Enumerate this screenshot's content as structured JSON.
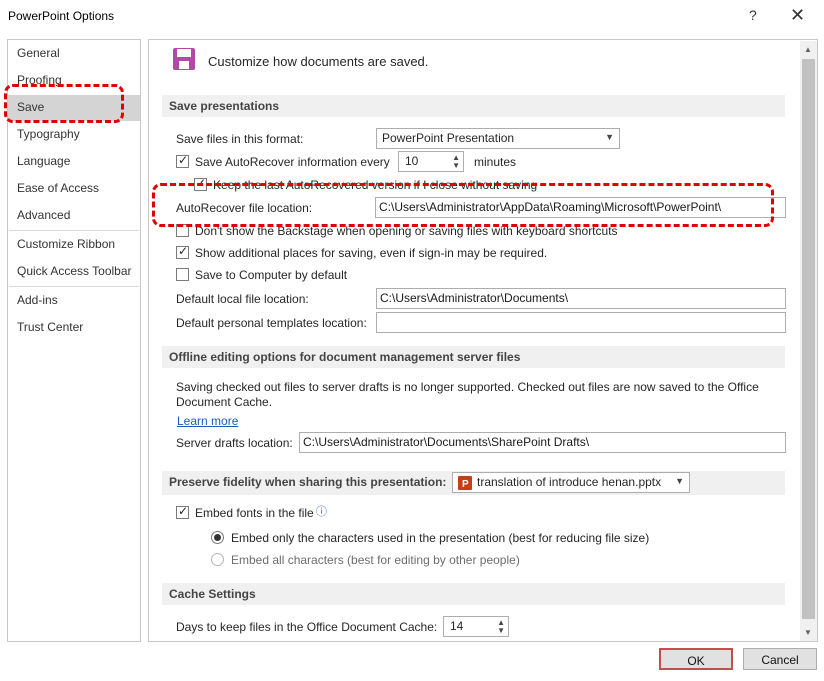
{
  "window": {
    "title": "PowerPoint Options",
    "help": "?",
    "close": "✕"
  },
  "nav": {
    "items": [
      "General",
      "Proofing",
      "Save",
      "Typography",
      "Language",
      "Ease of Access",
      "Advanced",
      "Customize Ribbon",
      "Quick Access Toolbar",
      "Add-ins",
      "Trust Center"
    ],
    "selected": "Save"
  },
  "header": {
    "text": "Customize how documents are saved."
  },
  "save_presentations": {
    "title": "Save presentations",
    "format_label": "Save files in this format:",
    "format_value": "PowerPoint Presentation",
    "autorecover_label": "Save AutoRecover information every",
    "autorecover_value": "10",
    "minutes_label": "minutes",
    "keep_last_label": "Keep the last AutoRecovered version if I close without saving",
    "autorecover_location_label": "AutoRecover file location:",
    "autorecover_location_value": "C:\\Users\\Administrator\\AppData\\Roaming\\Microsoft\\PowerPoint\\",
    "dont_show_backstage_label": "Don't show the Backstage when opening or saving files with keyboard shortcuts",
    "show_additional_label": "Show additional places for saving, even if sign-in may be required.",
    "save_to_computer_label": "Save to Computer by default",
    "default_local_label": "Default local file location:",
    "default_local_value": "C:\\Users\\Administrator\\Documents\\",
    "default_templates_label": "Default personal templates location:",
    "default_templates_value": ""
  },
  "offline": {
    "title": "Offline editing options for document management server files",
    "info_line1": "Saving checked out files to server drafts is no longer supported. Checked out files are now saved to the Office",
    "info_line2": "Document Cache.",
    "learn_more": "Learn more",
    "drafts_label": "Server drafts location:",
    "drafts_value": "C:\\Users\\Administrator\\Documents\\SharePoint Drafts\\"
  },
  "fidelity": {
    "title": "Preserve fidelity when sharing this presentation:",
    "file_value": "translation of introduce henan.pptx",
    "embed_fonts_label": "Embed fonts in the file",
    "embed_only_label": "Embed only the characters used in the presentation (best for reducing file size)",
    "embed_all_label": "Embed all characters (best for editing by other people)"
  },
  "cache": {
    "title": "Cache Settings",
    "days_label": "Days to keep files in the Office Document Cache:",
    "days_value": "14"
  },
  "buttons": {
    "ok": "OK",
    "cancel": "Cancel"
  },
  "colors": {
    "annotation": "#e00000",
    "ok_border": "#c0504d",
    "link": "#1a5fb4",
    "save_icon": "#b04aa6"
  }
}
